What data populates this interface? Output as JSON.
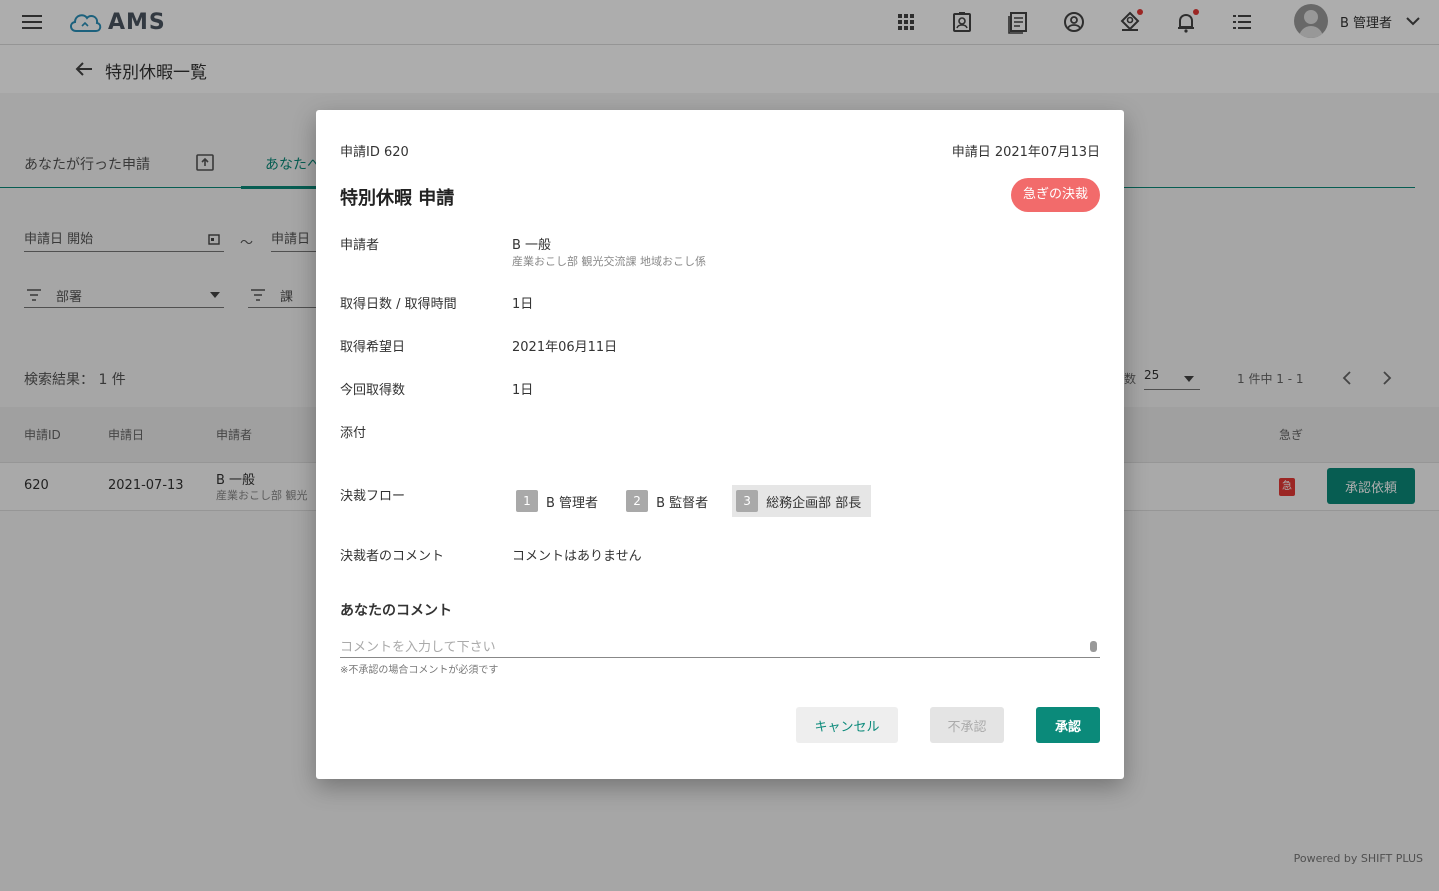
{
  "app": {
    "logo_text": "AMS",
    "user_name": "B 管理者"
  },
  "subheader": {
    "title": "特別休暇一覧"
  },
  "background": {
    "tabs": [
      "あなたが行った申請",
      "あなたへ"
    ],
    "filter_start_label": "申請日 開始",
    "filter_tilde": "～",
    "filter_end_label": "申請日",
    "filter_dept_label": "部署",
    "filter_section_label": "課",
    "results_label": "検索結果：",
    "results_count": "1 件",
    "per_page_label": "数",
    "per_page_value": "25",
    "page_range": "1 件中 1 - 1",
    "columns": [
      "申請ID",
      "申請日",
      "申請者",
      "急ぎ"
    ],
    "row": {
      "id": "620",
      "date": "2021-07-13",
      "applicant": "B 一般",
      "applicant_dept": "産業おこし部 観光",
      "urgent_mark": "急",
      "action": "承認依頼"
    },
    "powered_by": "Powered by SHIFT PLUS"
  },
  "modal": {
    "application_id": "申請ID 620",
    "application_date": "申請日 2021年07月13日",
    "title": "特別休暇 申請",
    "urgent_badge": "急ぎの決裁",
    "applicant_label": "申請者",
    "applicant_name": "B 一般",
    "applicant_dept": "産業おこし部 観光交流課 地域おこし係",
    "days_label": "取得日数 / 取得時間",
    "days_value": "1日",
    "desired_date_label": "取得希望日",
    "desired_date_value": "2021年06月11日",
    "current_label": "今回取得数",
    "current_value": "1日",
    "attachment_label": "添付",
    "flow_label": "決裁フロー",
    "flow": [
      {
        "num": "1",
        "name": "B 管理者"
      },
      {
        "num": "2",
        "name": "B 監督者"
      },
      {
        "num": "3",
        "name": "総務企画部 部長"
      }
    ],
    "approver_comment_label": "決裁者のコメント",
    "approver_comment_value": "コメントはありません",
    "your_comment_label": "あなたのコメント",
    "comment_placeholder": "コメントを入力して下さい",
    "comment_hint": "※不承認の場合コメントが必須です",
    "cancel_label": "キャンセル",
    "reject_label": "不承認",
    "approve_label": "承認"
  }
}
